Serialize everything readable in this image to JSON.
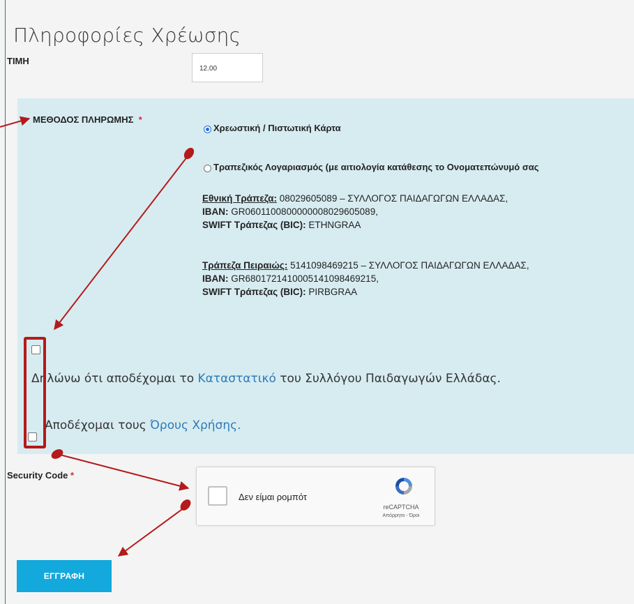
{
  "page_title": "Πληροφορίες Χρέωσης",
  "price": {
    "label": "ΤΙΜΗ",
    "value": "12.00"
  },
  "payment": {
    "label": "ΜΕΘΟΔΟΣ ΠΛΗΡΩΜΗΣ",
    "required_mark": "*",
    "options": [
      {
        "label": "Χρεωστική / Πιστωτική Κάρτα",
        "selected": true
      },
      {
        "label": "Τραπεζικός Λογαριασμός (με αιτιολογία κατάθεσης το Ονοματεπώνυμό σας",
        "selected": false
      }
    ]
  },
  "banks": [
    {
      "name": "Εθνική Τράπεζα:",
      "account": " 08029605089 – ΣΥΛΛΟΓΟΣ ΠΑΙΔΑΓΩΓΩΝ ΕΛΛΑΔΑΣ,",
      "iban_label": "IBAN:",
      "iban": " GR0601100800000008029605089,",
      "swift_label": "SWIFT Τράπεζας (BIC):",
      "swift": " ETHNGRAA"
    },
    {
      "name": "Τράπεζα Πειραιώς:",
      "account": " 5141098469215 – ΣΥΛΛΟΓΟΣ ΠΑΙΔΑΓΩΓΩΝ ΕΛΛΑΔΑΣ,",
      "iban_label": "IBAN:",
      "iban": " GR6801721410005141098469215,",
      "swift_label": "SWIFT Τράπεζας (BIC):",
      "swift": " PIRBGRAA"
    }
  ],
  "declaration": {
    "prefix": "Δηλώνω ότι αποδέχομαι το ",
    "link": "Καταστατικό",
    "suffix": " του Συλλόγου Παιδαγωγών Ελλάδας."
  },
  "terms": {
    "prefix": "Αποδέχομαι τους ",
    "link": "Όρους Χρήσης."
  },
  "security": {
    "label": "Security Code",
    "required_mark": "*"
  },
  "captcha": {
    "text": "Δεν είμαι ρομπότ",
    "brand": "reCAPTCHA",
    "terms": "Απόρρητο - Όροι"
  },
  "submit_label": "ΕΓΓΡΑΦΗ",
  "colors": {
    "panel": "#d7ecf1",
    "accent": "#13a9dc",
    "annotation": "#b51a1a",
    "link": "#2d7ab8"
  }
}
